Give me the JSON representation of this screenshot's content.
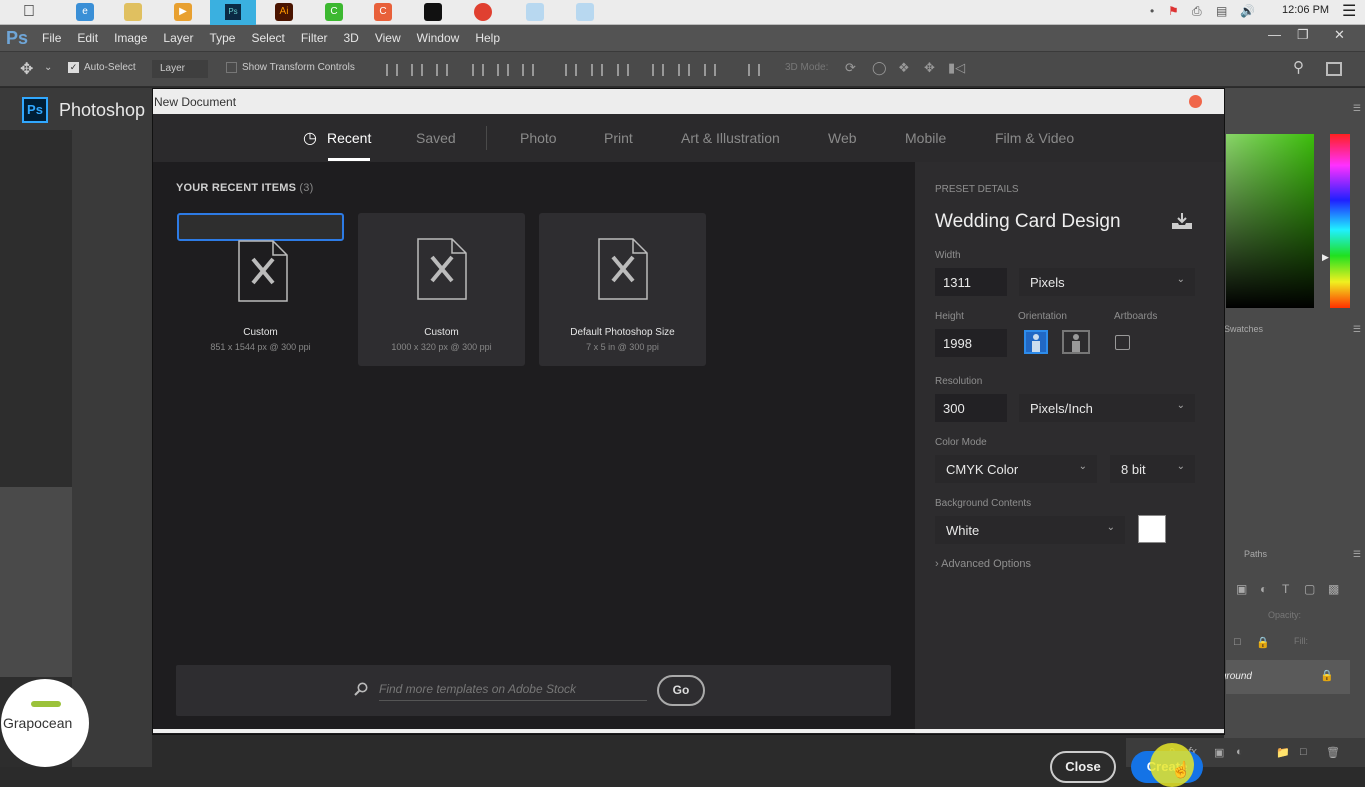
{
  "os_menubar": {
    "dock_icons": [
      "apple-icon",
      "internet-explorer-icon",
      "file-explorer-icon",
      "media-player-icon",
      "photoshop-icon",
      "illustrator-icon",
      "camtasia-recorder-icon",
      "camtasia-icon",
      "dwg-icon",
      "chrome-icon",
      "bottle-icon",
      "bottle-icon-2"
    ],
    "time": "12:06 PM"
  },
  "ps_menubar": {
    "logo": "Ps",
    "items": [
      "File",
      "Edit",
      "Image",
      "Layer",
      "Type",
      "Select",
      "Filter",
      "3D",
      "View",
      "Window",
      "Help"
    ]
  },
  "options_bar": {
    "auto_select_label": "Auto-Select",
    "auto_select_checked": true,
    "layer_select": "Layer",
    "show_transform_label": "Show Transform Controls",
    "mode_3d_label": "3D Mode:"
  },
  "home": {
    "app_name": "Photoshop",
    "ps_badge": "Ps"
  },
  "dialog": {
    "title": "New Document",
    "tabs": [
      {
        "label": "Recent",
        "active": true
      },
      {
        "label": "Saved"
      },
      {
        "label": "Photo"
      },
      {
        "label": "Print"
      },
      {
        "label": "Art & Illustration"
      },
      {
        "label": "Web"
      },
      {
        "label": "Mobile"
      },
      {
        "label": "Film & Video"
      }
    ],
    "recent_heading": "YOUR RECENT ITEMS",
    "recent_count": "(3)",
    "recent_items": [
      {
        "name": "Custom",
        "size": "851 x 1544 px @ 300 ppi",
        "selected": true
      },
      {
        "name": "Custom",
        "size": "1000 x 320 px @ 300 ppi"
      },
      {
        "name": "Default Photoshop Size",
        "size": "7 x 5 in @ 300 ppi"
      }
    ],
    "stock_search": {
      "placeholder": "Find more templates on Adobe Stock",
      "go_label": "Go"
    },
    "preset": {
      "section_label": "PRESET DETAILS",
      "name": "Wedding Card Design",
      "width_label": "Width",
      "width_value": "1311",
      "width_unit": "Pixels",
      "height_label": "Height",
      "height_value": "1998",
      "orientation_label": "Orientation",
      "orientation": "portrait",
      "artboards_label": "Artboards",
      "artboards_checked": false,
      "resolution_label": "Resolution",
      "resolution_value": "300",
      "resolution_unit": "Pixels/Inch",
      "color_mode_label": "Color Mode",
      "color_mode": "CMYK Color",
      "bit_depth": "8 bit",
      "background_label": "Background Contents",
      "background": "White",
      "background_color": "#ffffff",
      "advanced_label": "Advanced Options"
    },
    "close_label": "Close",
    "create_label": "Create"
  },
  "right_panels": {
    "swatches_tab": "Swatches",
    "paths_tab": "Paths",
    "opacity_label": "Opacity:",
    "fill_label": "Fill:",
    "layer_name": "Background"
  },
  "watermark": {
    "text": "Grapocean"
  },
  "colors": {
    "accent": "#1473e6",
    "selection": "#2d7be5",
    "close_dot": "#f0664a"
  }
}
